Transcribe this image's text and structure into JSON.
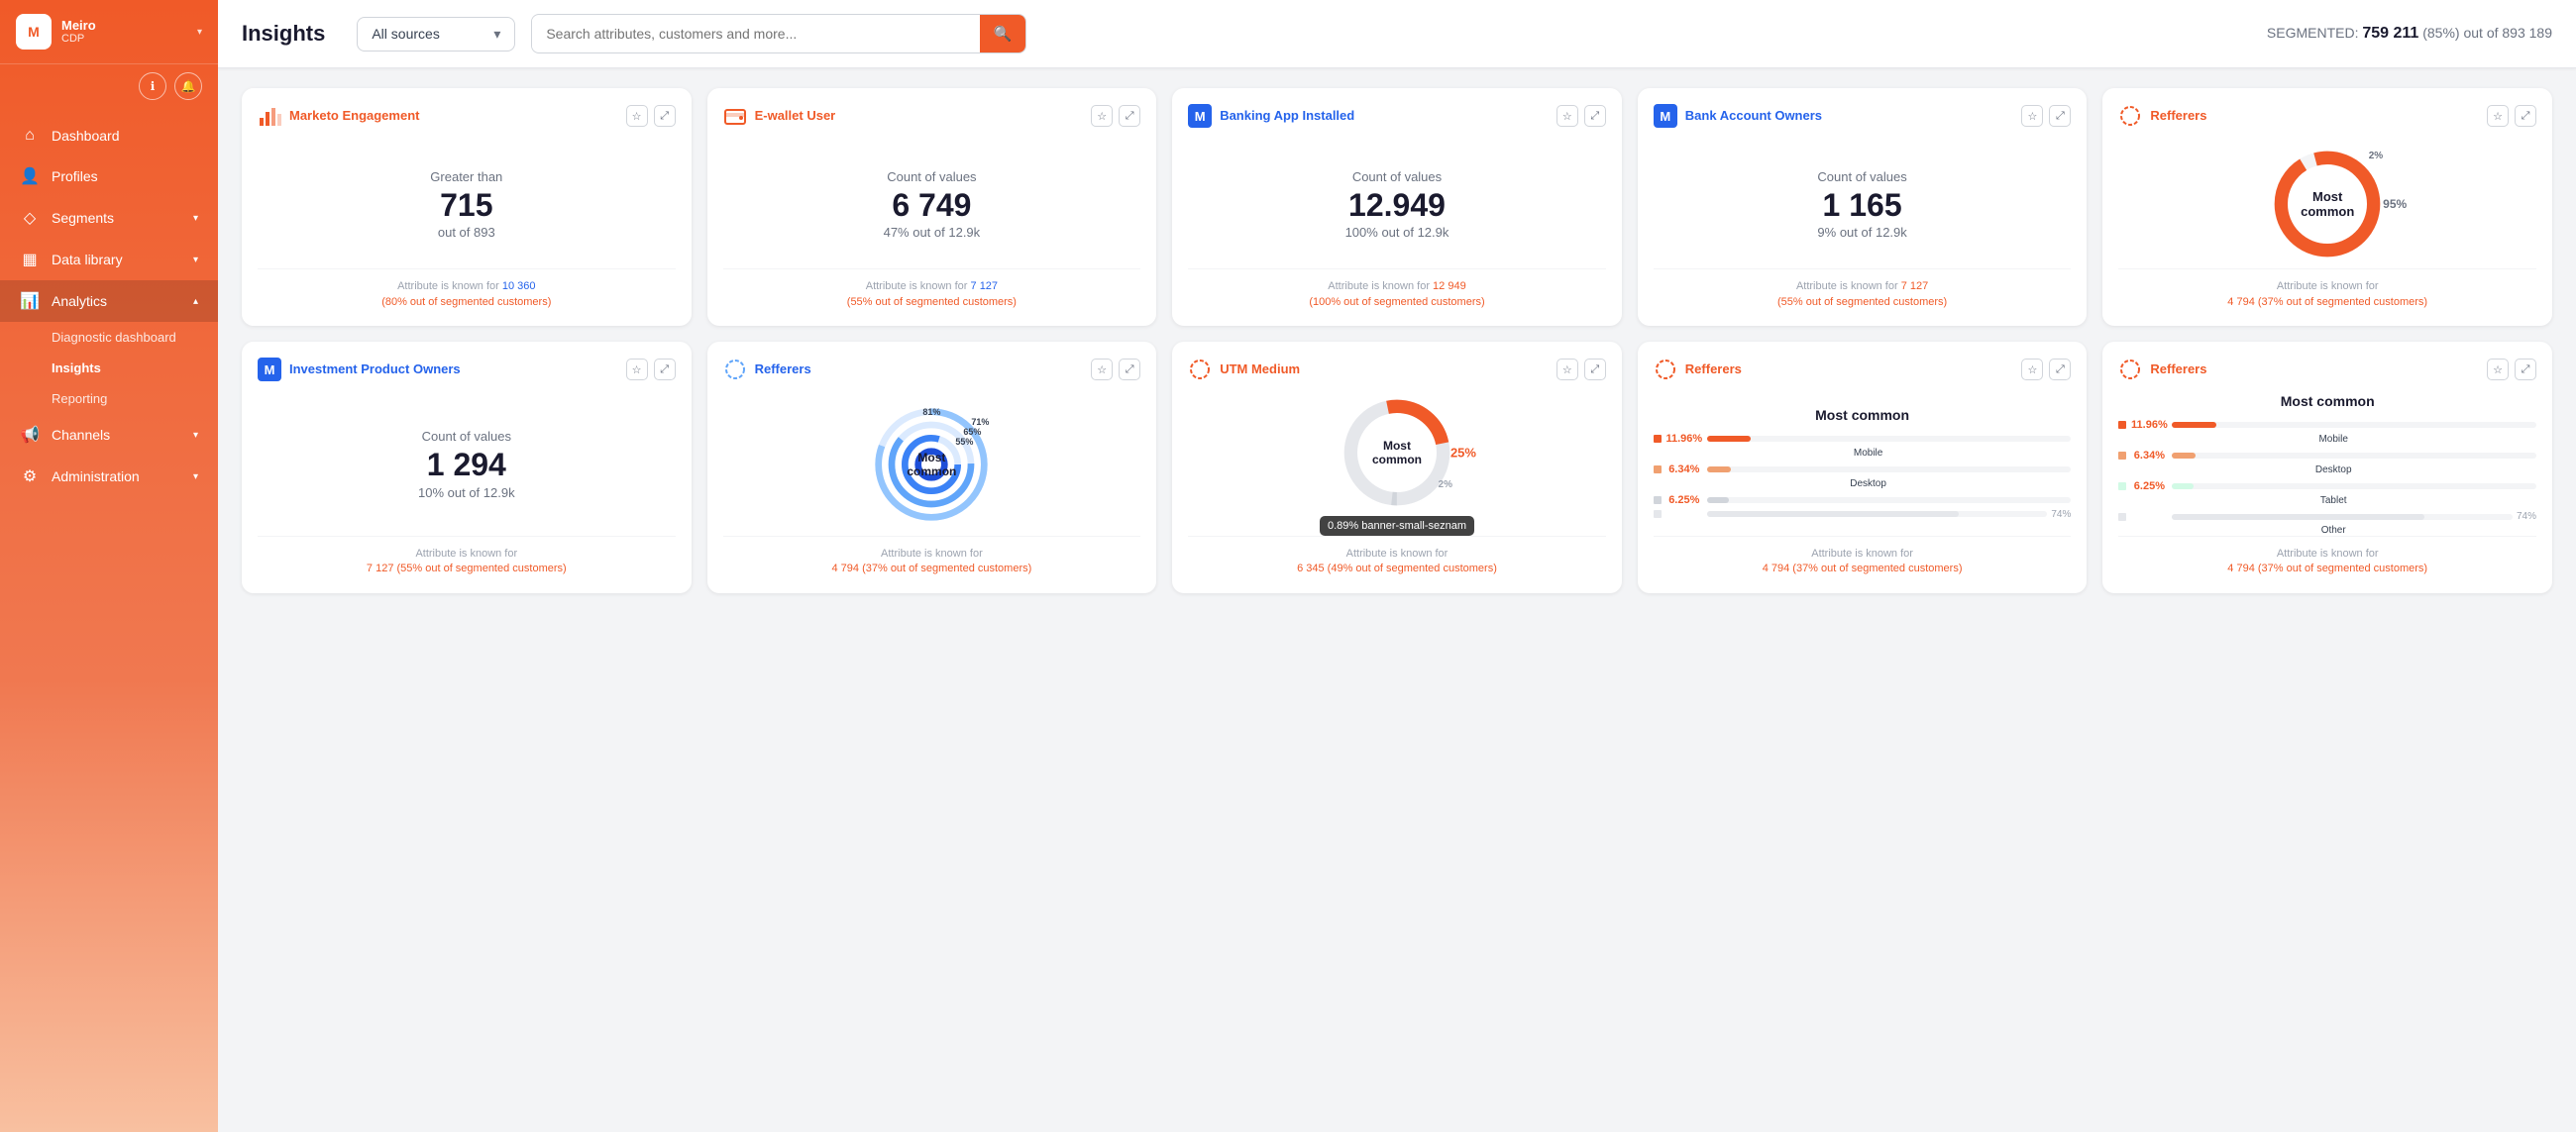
{
  "sidebar": {
    "logo": {
      "abbr": "M",
      "name": "Meiro",
      "sub": "CDP",
      "caret": "▾"
    },
    "nav_items": [
      {
        "id": "dashboard",
        "icon": "⌂",
        "label": "Dashboard",
        "hasArrow": false
      },
      {
        "id": "profiles",
        "icon": "👤",
        "label": "Profiles",
        "hasArrow": false
      },
      {
        "id": "segments",
        "icon": "◇",
        "label": "Segments",
        "hasArrow": true
      },
      {
        "id": "data-library",
        "icon": "▦",
        "label": "Data library",
        "hasArrow": true
      },
      {
        "id": "analytics",
        "icon": "📊",
        "label": "Analytics",
        "hasArrow": true,
        "active": true
      },
      {
        "id": "channels",
        "icon": "📢",
        "label": "Channels",
        "hasArrow": true
      },
      {
        "id": "administration",
        "icon": "⚙",
        "label": "Administration",
        "hasArrow": true
      }
    ],
    "sub_items": [
      {
        "id": "diagnostic",
        "label": "Diagnostic dashboard"
      },
      {
        "id": "insights",
        "label": "Insights",
        "active": true
      },
      {
        "id": "reporting",
        "label": "Reporting"
      }
    ]
  },
  "header": {
    "title": "Insights",
    "source_label": "All sources",
    "search_placeholder": "Search attributes, customers and more...",
    "segmented_label": "SEGMENTED:",
    "segmented_count": "759 211",
    "segmented_pct": "(85%)",
    "segmented_total": "out of 893 189"
  },
  "cards": [
    {
      "id": "marketo",
      "title": "Marketo Engagement",
      "icon_color": "#f05a28",
      "icon_type": "bars",
      "type": "stat",
      "label": "Greater than",
      "number": "715",
      "sub": "out of 893",
      "footer": "Attribute is known for 10 360\n(80% out of segmented customers)",
      "footer_link": "10 360",
      "footer_link2": "(80% out of segmented customers)"
    },
    {
      "id": "ewallet",
      "title": "E-wallet User",
      "icon_color": "#f05a28",
      "icon_type": "wallet",
      "type": "stat",
      "label": "Count of values",
      "number": "6 749",
      "sub": "47% out of 12.9k",
      "footer": "Attribute is known for 7 127\n(55% out of segmented customers)",
      "footer_link": "7 127",
      "footer_link2": "(55% out of segmented customers)"
    },
    {
      "id": "banking-app",
      "title": "Banking App Installed",
      "icon_color": "#2563eb",
      "icon_type": "M",
      "type": "stat",
      "label": "Count of values",
      "number": "12.949",
      "sub": "100% out of 12.9k",
      "footer": "Attribute is known for 12 949\n(100% out of segmented customers)",
      "footer_link": "12 949",
      "footer_link2": "(100% out of segmented customers)"
    },
    {
      "id": "bank-account",
      "title": "Bank Account Owners",
      "icon_color": "#2563eb",
      "icon_type": "M",
      "type": "stat",
      "label": "Count of values",
      "number": "1 165",
      "sub": "9% out of 12.9k",
      "footer": "Attribute is known for 7 127\n(55% out of segmented customers)",
      "footer_link": "7 127",
      "footer_link2": "(55% out of segmented customers)"
    },
    {
      "id": "refferers-1",
      "title": "Refferers",
      "icon_color": "#f05a28",
      "icon_type": "circle",
      "type": "donut",
      "label": "Most common",
      "pct_main": "95%",
      "pct_small": "2%",
      "donut_color": "#f05a28",
      "donut_pct": 95,
      "footer": "Attribute is known for\n4 794 (37% out of segmented customers)",
      "footer_link": "4 794",
      "footer_link2": "(37% out of segmented customers)"
    },
    {
      "id": "investment-product",
      "title": "Investment Product Owners",
      "icon_color": "#2563eb",
      "icon_type": "M",
      "type": "stat",
      "label": "Count of values",
      "number": "1 294",
      "sub": "10% out of 12.9k",
      "footer": "Attribute is known for\n7 127 (55% out of segmented customers)",
      "footer_link": "7 127",
      "footer_link2": "(55% out of segmented customers)"
    },
    {
      "id": "refferers-2",
      "title": "Refferers",
      "icon_color": "#2563eb",
      "icon_type": "circle-blue",
      "type": "concentric",
      "label": "Most common",
      "pcts": [
        "81%",
        "71%",
        "65%",
        "55%"
      ],
      "footer": "Attribute is known for\n4 794 (37% out of segmented customers)",
      "footer_link": "4 794",
      "footer_link2": "(37% out of segmented customers)"
    },
    {
      "id": "utm-medium",
      "title": "UTM Medium",
      "icon_color": "#f05a28",
      "icon_type": "circle",
      "type": "donut-partial",
      "label": "Most common",
      "pct_main": "25%",
      "pct_small": "2%",
      "donut_color": "#f05a28",
      "donut_pct": 25,
      "tooltip": "0.89% banner-small-seznam",
      "footer": "Attribute is known for\n6 345 (49% out of segmented customers)",
      "footer_link": "6 345",
      "footer_link2": "(49% out of segmented customers)"
    },
    {
      "id": "refferers-3",
      "title": "Refferers",
      "icon_color": "#f05a28",
      "icon_type": "circle",
      "type": "bar-chart",
      "label": "Most common",
      "bars": [
        {
          "label": "",
          "pct": "11.96%",
          "fill": 12,
          "num": ""
        },
        {
          "label": "Mobile",
          "color": "#f05a28"
        },
        {
          "label": "",
          "pct": "6.34%",
          "fill": 6.5,
          "num": ""
        },
        {
          "label": "Desktop",
          "color": "#f0a070"
        },
        {
          "label": "",
          "pct": "6.25%",
          "fill": 6,
          "num": ""
        },
        {
          "label": "",
          "color": "#e5e7eb",
          "fill_pct": 74,
          "num": "74%"
        }
      ],
      "footer": "Attribute is known for\n4 794 (37% out of segmented customers)",
      "footer_link": "4 794",
      "footer_link2": "(37% out of segmented customers)"
    },
    {
      "id": "refferers-4",
      "title": "Refferers",
      "icon_color": "#f05a28",
      "icon_type": "circle",
      "type": "bar-chart-2",
      "label": "Most common",
      "bars2": [
        {
          "pct_label": "11.96%",
          "fill": 12,
          "name": "Mobile"
        },
        {
          "pct_label": "6.34%",
          "fill": 6.5,
          "name": "Desktop"
        },
        {
          "pct_label": "6.25%",
          "fill": 6,
          "name": "Tablet"
        },
        {
          "pct_label": "74%",
          "fill": 74,
          "name": "Other",
          "gray": true
        }
      ],
      "footer": "Attribute is known for\n4 794 (37% out of segmented customers)",
      "footer_link": "4 794",
      "footer_link2": "(37% out of segmented customers)"
    }
  ]
}
